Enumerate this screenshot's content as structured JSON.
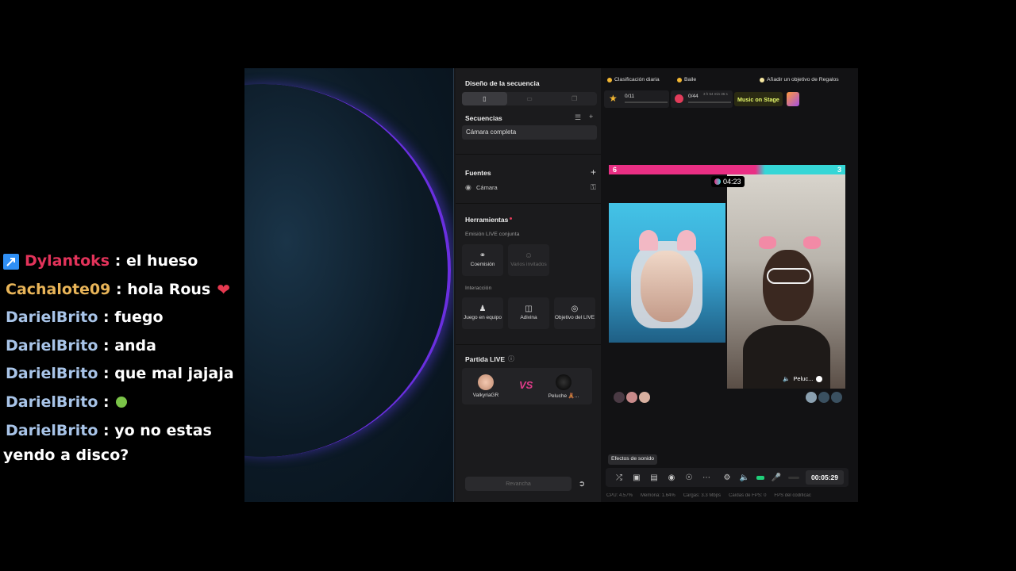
{
  "chat": [
    {
      "user": "Dylantoks",
      "user_color": "#e2335a",
      "message": ": el hueso",
      "badge": "pin-icon"
    },
    {
      "user": "Cachalote09",
      "user_color": "#e8b458",
      "message": ": hola Rous",
      "suffix_icon": "heart-icon"
    },
    {
      "user": "DarielBrito",
      "user_color": "#a8c4e8",
      "message": ": fuego"
    },
    {
      "user": "DarielBrito",
      "user_color": "#a8c4e8",
      "message": ": anda"
    },
    {
      "user": "DarielBrito",
      "user_color": "#a8c4e8",
      "message": ": que mal jajaja"
    },
    {
      "user": "DarielBrito",
      "user_color": "#a8c4e8",
      "message": ":",
      "suffix_icon": "emoji-icon"
    },
    {
      "user": "DarielBrito",
      "user_color": "#a8c4e8",
      "message": ": yo no estas yendo a disco?"
    }
  ],
  "panel": {
    "sequence_design": "Diseño de la secuencia",
    "sequences": "Secuencias",
    "full_camera": "Cámara completa",
    "sources": "Fuentes",
    "camera": "Cámara",
    "tools": "Herramientas",
    "joint_live": "Emisión LIVE conjunta",
    "cohost": "Coemisión",
    "guests": "Varios invitados",
    "interaction": "Interacción",
    "team_game": "Juego en equipo",
    "guess": "Adivina",
    "live_goal": "Objetivo del LIVE",
    "live_match": "Partida LIVE",
    "player_left": "ValkyriaGR",
    "player_right": "Peluche 🧸...",
    "vs": "VS",
    "rematch": "Revancha"
  },
  "stage": {
    "daily_rank": "Clasificación diaria",
    "dance": "Baile",
    "add_gift_goal": "Añadir un objetivo de Regalos",
    "stat1": "0/11",
    "stat2": "0/44",
    "stat2_time": "3 h 54 min 36 s",
    "music_on_stage": "Music on Stage",
    "score_left": "6",
    "score_right": "3",
    "battle_timer": "04:23",
    "right_cam_label": "Peluc...",
    "tooltip": "Efectos de sonido",
    "elapsed": "00:05:29"
  },
  "status": {
    "cpu": "CPU: 4.57%",
    "memory": "Memoria: 1.64%",
    "load": "Cargas: 3.3 Mbps",
    "fps_drops": "Caídas de FPS: 0",
    "fps_encoder": "FPS del codificac"
  },
  "colors": {
    "battle_pink": "#e92f84",
    "battle_cyan": "#35d6d6",
    "timer_green": "#1fd07a",
    "music_yellow": "#e5f86a"
  }
}
